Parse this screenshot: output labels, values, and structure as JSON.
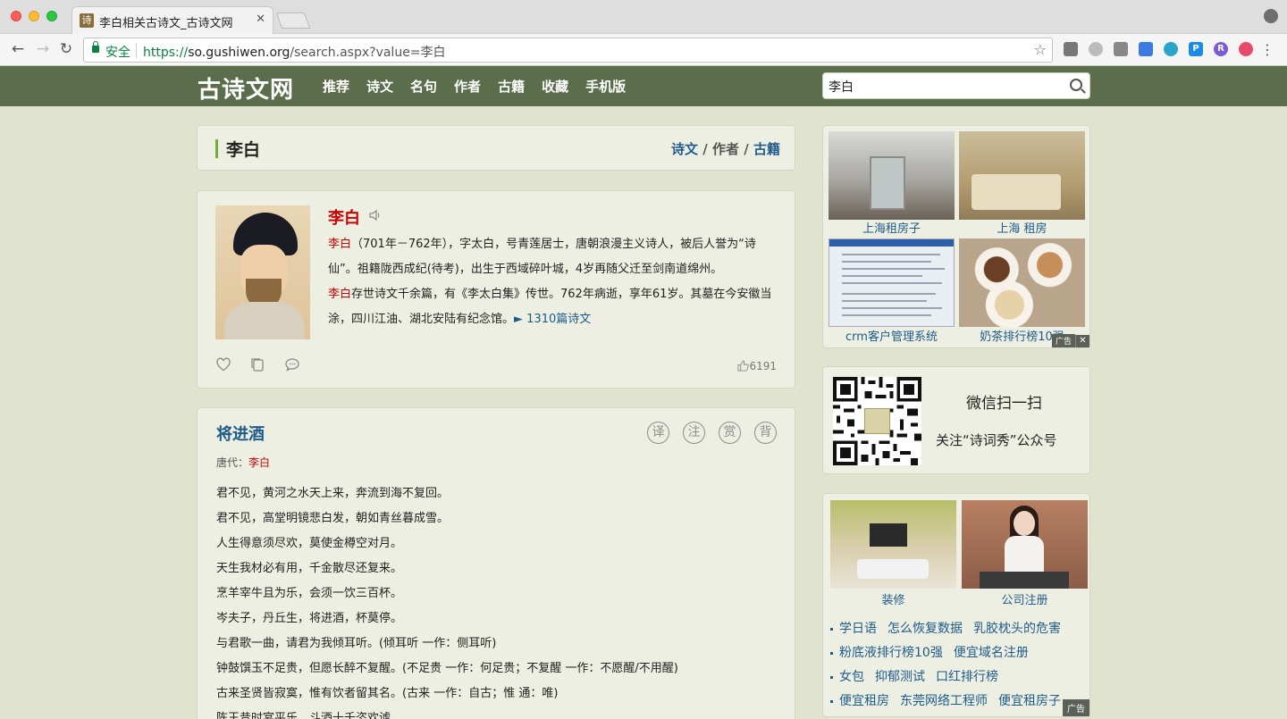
{
  "browser": {
    "tab_title": "李白相关古诗文_古诗文网",
    "tab_favicon": "诗",
    "tab_close": "✕",
    "secure_label": "安全",
    "url_scheme": "https://",
    "url_host": "so.gushiwen.org",
    "url_path": "/search.aspx?value=李白"
  },
  "header": {
    "logo": "古诗文网",
    "nav": [
      "推荐",
      "诗文",
      "名句",
      "作者",
      "古籍",
      "收藏",
      "手机版"
    ],
    "search_value": "李白"
  },
  "result_title": {
    "text": "李白",
    "links": [
      "诗文",
      "作者",
      "古籍"
    ],
    "sep": "/"
  },
  "author": {
    "name": "李白",
    "bio_name": "李白",
    "bio_part1": "（701年－762年），字太白，号青莲居士，唐朝浪漫主义诗人，被后人誉为“诗仙”。祖籍陇西成纪(待考)，出生于西域碎叶城，4岁再随父迁至剑南道绵州。",
    "bio_name2": "李白",
    "bio_part2": "存世诗文千余篇，有《李太白集》传世。762年病逝，享年61岁。其墓在今安徽当涂，四川江油、湖北安陆有纪念馆。",
    "poems_link": "► 1310篇诗文",
    "like_count": "6191"
  },
  "poem": {
    "title": "将进酒",
    "tools": [
      "译",
      "注",
      "赏",
      "背"
    ],
    "dynasty_label": "唐代：",
    "author": "李白",
    "lines": [
      "君不见，黄河之水天上来，奔流到海不复回。",
      "君不见，高堂明镜悲白发，朝如青丝暮成雪。",
      "人生得意须尽欢，莫使金樽空对月。",
      "天生我材必有用，千金散尽还复来。",
      "烹羊宰牛且为乐，会须一饮三百杯。",
      "岑夫子，丹丘生，将进酒，杯莫停。",
      "与君歌一曲，请君为我倾耳听。(倾耳听 一作：侧耳听)",
      "钟鼓馔玉不足贵，但愿长醉不复醒。(不足贵 一作：何足贵；不复醒 一作：不愿醒/不用醒)",
      "古来圣贤皆寂寞，惟有饮者留其名。(古来 一作：自古；惟 通：唯)",
      "陈王昔时宴平乐，斗酒十千恣欢谑。"
    ]
  },
  "ad1": {
    "captions": [
      "上海租房子",
      "上海 租房",
      "crm客户管理系统",
      "奶茶排行榜10强"
    ],
    "tag": "广告",
    "close": "✕"
  },
  "qr": {
    "line1": "微信扫一扫",
    "line2": "关注“诗词秀”公众号"
  },
  "ad2": {
    "captions": [
      "装修",
      "公司注册"
    ],
    "link_lines": [
      [
        "学日语",
        "怎么恢复数据",
        "乳胶枕头的危害"
      ],
      [
        "粉底液排行榜10强",
        "便宜域名注册"
      ],
      [
        "女包",
        "抑郁测试",
        "口红排行榜"
      ],
      [
        "便宜租房",
        "东莞网络工程师",
        "便宜租房子"
      ]
    ],
    "tag": "广告"
  },
  "colors": {
    "header_bg": "#5b6d4b",
    "page_bg": "#e0e4cf",
    "card_bg": "#ecefe2",
    "link": "#1f5b8a",
    "accent_red": "#cc0000"
  }
}
